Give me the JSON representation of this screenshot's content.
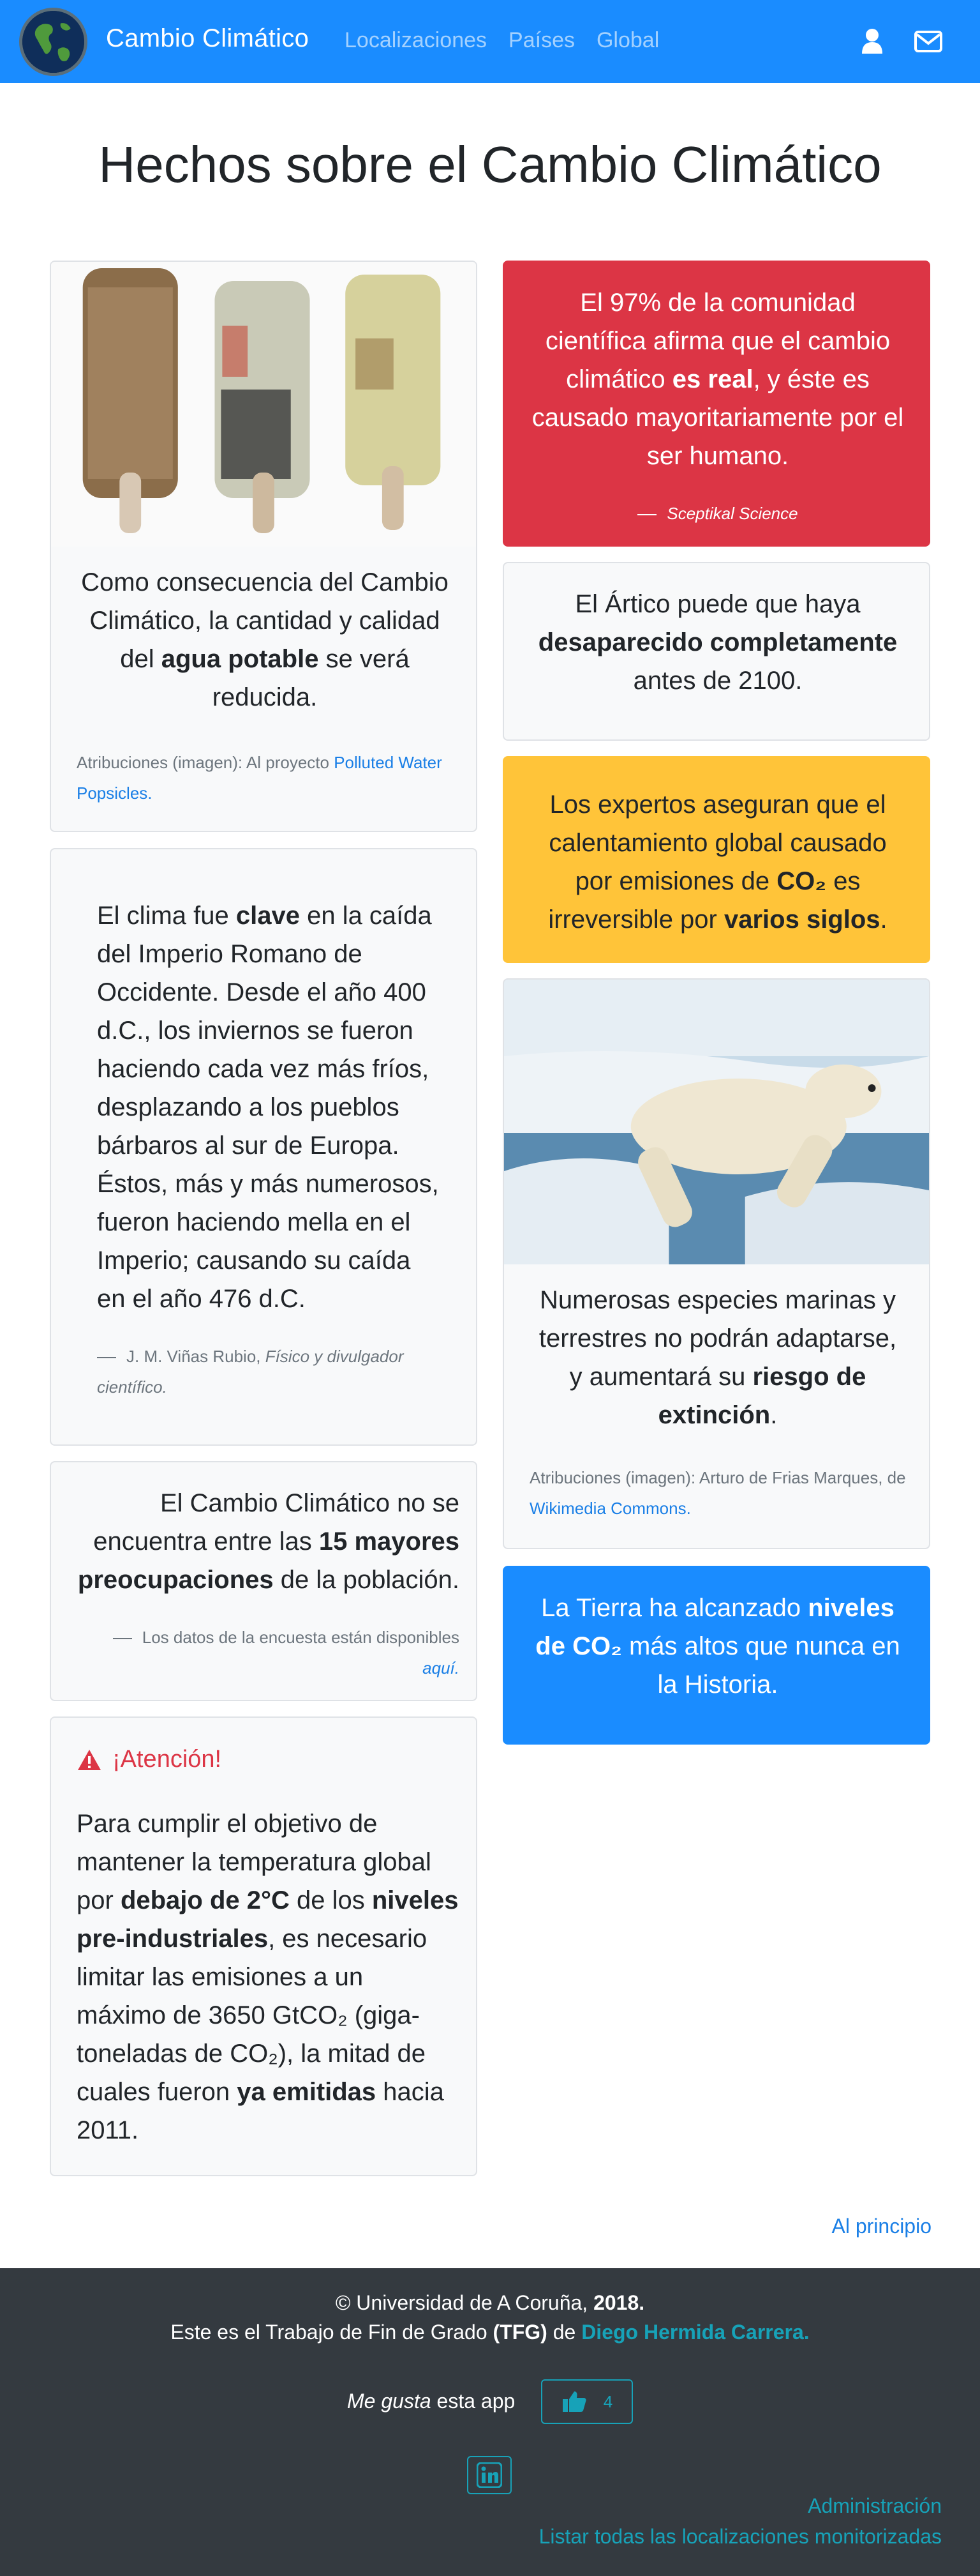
{
  "nav": {
    "brand": "Cambio Climático",
    "links": [
      "Localizaciones",
      "Países",
      "Global"
    ],
    "icons": [
      "user-icon",
      "envelope-icon"
    ]
  },
  "title": "Hechos sobre el Cambio Climático",
  "cards": {
    "water": {
      "text_pre": "Como consecuencia del Cambio Climático, la cantidad y calidad del ",
      "text_bold": "agua potable",
      "text_post": " se verá reducida.",
      "credit_pre": "Atribuciones (imagen): Al proyecto ",
      "credit_link": "Polluted Water Popsicles",
      "credit_post": "."
    },
    "rome": {
      "t1": "El clima fue ",
      "b1": "clave",
      "t2": " en la caída del Imperio Romano de Occidente. Desde el año 400 d.C., los inviernos se fueron haciendo cada vez más fríos, desplazando a los pueblos bárbaros al sur de Europa. Éstos, más y más numerosos, fueron haciendo mella en el Imperio; causando su caída en el año 476 d.C.",
      "cite_name": "J. M. Viñas Rubio, ",
      "cite_role": "Físico y divulgador científico."
    },
    "survey": {
      "t1": "El Cambio Climático no se encuentra entre las ",
      "b1": "15 mayores preocupaciones",
      "t2": " de la población.",
      "cite_text": "Los datos de la encuesta están disponibles ",
      "cite_link": "aquí",
      "cite_end": "."
    },
    "attention": {
      "heading": "¡Atención!",
      "t1": "Para cumplir el objetivo de mantener la temperatura global por ",
      "b1": "debajo de 2°C",
      "t2": " de los ",
      "b2": "niveles pre-industriales",
      "t3": ", es necesario limitar las emisiones a un máximo de 3650 GtCO₂ (giga-toneladas de CO₂), la mitad de cuales fueron ",
      "b3": "ya emitidas",
      "t4": " hacia 2011."
    },
    "consensus": {
      "t1": "El 97% de la comunidad científica afirma que el cambio climático ",
      "b1": "es real",
      "t2": ", y éste es causado mayoritariamente por el ser humano.",
      "cite": "Sceptikal Science"
    },
    "arctic": {
      "t1": "El Ártico puede que haya ",
      "b1": "desaparecido completamente",
      "t2": " antes de 2100."
    },
    "experts": {
      "t1": "Los expertos aseguran que el calentamiento global causado por emisiones de ",
      "b1": "CO₂",
      "t2": " es irreversible por ",
      "b2": "varios siglos",
      "t3": "."
    },
    "species": {
      "t1": "Numerosas especies marinas y terrestres no podrán adaptarse, y aumentará su ",
      "b1": "riesgo de extinción",
      "t2": ".",
      "credit_pre": "Atribuciones (imagen): Arturo de Frias Marques, de ",
      "credit_link": "Wikimedia Commons",
      "credit_post": "."
    },
    "co2": {
      "t1": "La Tierra ha alcanzado ",
      "b1": "niveles de CO₂",
      "t2": " más altos que nunca en la Historia."
    }
  },
  "footer": {
    "back_to_top": "Al principio",
    "copyright_pre": "© Universidad de A Coruña, ",
    "copyright_year": "2018.",
    "tfg_pre": "Este es el Trabajo de Fin de Grado ",
    "tfg_bold": "(TFG)",
    "tfg_mid": " de ",
    "tfg_author": "Diego Hermida Carrera.",
    "like_em": "Me gusta",
    "like_rest": " esta app",
    "like_count": "4",
    "admin_link": "Administración",
    "list_link": "Listar todas las localizaciones monitorizadas"
  },
  "colors": {
    "navbar": "#1a8cff",
    "danger": "#dc3545",
    "warning": "#ffc439",
    "primary": "#1a8cff",
    "teal": "#17a2b8",
    "footer": "#343a40"
  }
}
